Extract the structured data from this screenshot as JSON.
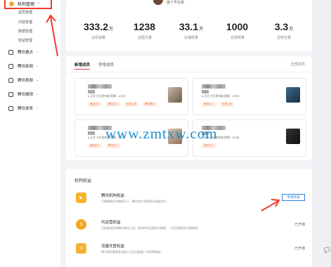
{
  "sidebar": {
    "header": {
      "label": "机构管理"
    },
    "sub_items": [
      "成员管理",
      "内容管理",
      "数据管理",
      "收益管理"
    ],
    "groups": [
      "腾讯看点",
      "腾讯新闻",
      "腾讯视频",
      "腾讯微视",
      "腾讯体育"
    ]
  },
  "account": {
    "name": "旗下号名称"
  },
  "stats": [
    {
      "value": "333.2",
      "unit": "万",
      "label": "总阅读量"
    },
    {
      "value": "1238",
      "unit": "",
      "label": "总图文量"
    },
    {
      "value": "33.1",
      "unit": "万",
      "label": "总播放量"
    },
    {
      "value": "1000",
      "unit": "",
      "label": "总视频量"
    },
    {
      "value": "3.3",
      "unit": "万",
      "label": "总粉丝量"
    }
  ],
  "members": {
    "tabs": [
      "新增成员",
      "异常成员"
    ],
    "all_link": "全部成员",
    "cards": [
      {
        "meta": "● 正式    七日发布量  视频：100分",
        "badges": [
          "原创达人",
          "腾讯达人",
          "优质入驻",
          "腾讯看点"
        ]
      },
      {
        "meta": "● 正式    七日发布量  视频：100分",
        "badges": [
          "原创达人",
          "优质入驻"
        ]
      },
      {
        "meta": "● 正式    七日发布量  视频：100分",
        "badges": [
          "原创达人",
          "腾讯达人"
        ]
      },
      {
        "meta": "● 正式    七日发布量  视频：100分",
        "badges": [
          "原创达人"
        ]
      }
    ]
  },
  "watermark": "www.zmtxw.com",
  "benefits": {
    "title": "机构权益",
    "items": [
      {
        "name": "腾讯机构权益",
        "desc": "可查看成员在微视达人、腾讯发文并接受与发展合作。",
        "status": "",
        "button": "申请开通",
        "color": "#f7b52c"
      },
      {
        "name": "代运营权益",
        "desc": "可查看成员的稿件操作上线，由机构代运营进行管理。《代运营权益开通说明》",
        "status": "已开通",
        "button": "",
        "color": "#f4a623"
      },
      {
        "name": "流量托管权益",
        "desc": "将可获托管制享全能人工资分配推广并获得数据。",
        "status": "已开通",
        "button": "",
        "color": "#f1b533"
      }
    ]
  },
  "colors": {
    "accent_red": "#ef3b2d",
    "badge_orange": "#e8733b",
    "link_blue": "#2f7ee6",
    "watermark_blue": "#1a8fd0"
  }
}
